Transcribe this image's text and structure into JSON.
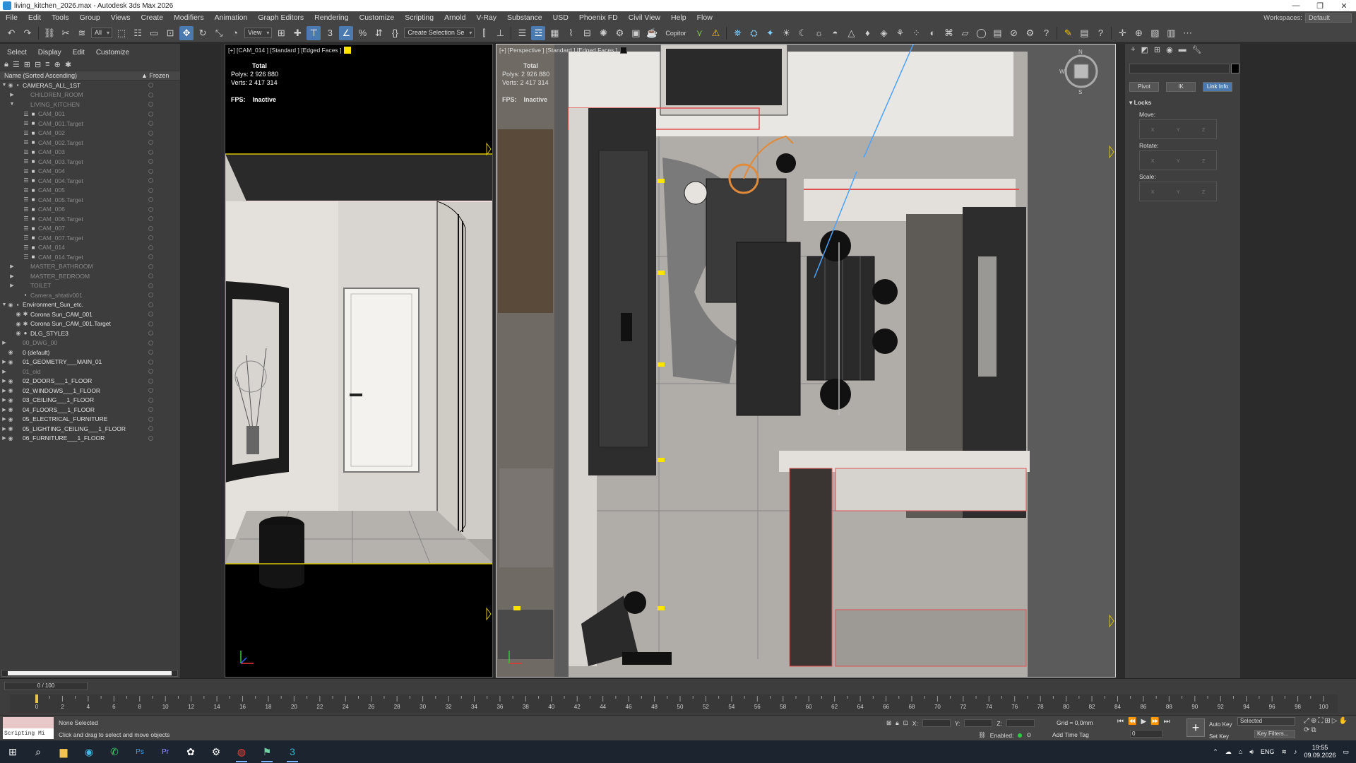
{
  "window": {
    "title": "living_kitchen_2026.max - Autodesk 3ds Max 2026",
    "controls": [
      "—",
      "❐",
      "✕"
    ]
  },
  "menubar": {
    "items": [
      "File",
      "Edit",
      "Tools",
      "Group",
      "Views",
      "Create",
      "Modifiers",
      "Animation",
      "Graph Editors",
      "Rendering",
      "Customize",
      "Scripting",
      "Arnold",
      "V-Ray",
      "Substance",
      "USD",
      "Phoenix FD",
      "Civil View",
      "Help",
      "Flow"
    ],
    "workspaces_label": "Workspaces:",
    "workspaces_value": "Default"
  },
  "toolbar": {
    "selection_filter": "All",
    "ref_coord": "View",
    "named_selection": "Create Selection Se",
    "copitor_label": "Copitor",
    "accent_color": "#4a7ab0"
  },
  "explorer": {
    "menu": [
      "Select",
      "Display",
      "Edit",
      "Customize"
    ],
    "col_name": "Name (Sorted Ascending)",
    "col_frozen": "▲ Frozen",
    "rows": [
      {
        "indent": 0,
        "expand": "▼",
        "eye": "◉",
        "name": "CAMERAS_ALL_1ST",
        "dim": false,
        "obj": "▪"
      },
      {
        "indent": 1,
        "expand": "▶",
        "eye": "",
        "name": "CHILDREN_ROOM",
        "dim": true,
        "obj": ""
      },
      {
        "indent": 1,
        "expand": "▼",
        "eye": "",
        "name": "LIVING_KITCHEN",
        "dim": true,
        "obj": ""
      },
      {
        "indent": 2,
        "expand": "",
        "eye": "☰",
        "name": "CAM_001",
        "dim": true,
        "obj": "■"
      },
      {
        "indent": 2,
        "expand": "",
        "eye": "☰",
        "name": "CAM_001.Target",
        "dim": true,
        "obj": "■"
      },
      {
        "indent": 2,
        "expand": "",
        "eye": "☰",
        "name": "CAM_002",
        "dim": true,
        "obj": "■"
      },
      {
        "indent": 2,
        "expand": "",
        "eye": "☰",
        "name": "CAM_002.Target",
        "dim": true,
        "obj": "■"
      },
      {
        "indent": 2,
        "expand": "",
        "eye": "☰",
        "name": "CAM_003",
        "dim": true,
        "obj": "■"
      },
      {
        "indent": 2,
        "expand": "",
        "eye": "☰",
        "name": "CAM_003.Target",
        "dim": true,
        "obj": "■"
      },
      {
        "indent": 2,
        "expand": "",
        "eye": "☰",
        "name": "CAM_004",
        "dim": true,
        "obj": "■"
      },
      {
        "indent": 2,
        "expand": "",
        "eye": "☰",
        "name": "CAM_004.Target",
        "dim": true,
        "obj": "■"
      },
      {
        "indent": 2,
        "expand": "",
        "eye": "☰",
        "name": "CAM_005",
        "dim": true,
        "obj": "■"
      },
      {
        "indent": 2,
        "expand": "",
        "eye": "☰",
        "name": "CAM_005.Target",
        "dim": true,
        "obj": "■"
      },
      {
        "indent": 2,
        "expand": "",
        "eye": "☰",
        "name": "CAM_006",
        "dim": true,
        "obj": "■"
      },
      {
        "indent": 2,
        "expand": "",
        "eye": "☰",
        "name": "CAM_006.Target",
        "dim": true,
        "obj": "■"
      },
      {
        "indent": 2,
        "expand": "",
        "eye": "☰",
        "name": "CAM_007",
        "dim": true,
        "obj": "■"
      },
      {
        "indent": 2,
        "expand": "",
        "eye": "☰",
        "name": "CAM_007.Target",
        "dim": true,
        "obj": "■"
      },
      {
        "indent": 2,
        "expand": "",
        "eye": "☰",
        "name": "CAM_014",
        "dim": true,
        "obj": "■"
      },
      {
        "indent": 2,
        "expand": "",
        "eye": "☰",
        "name": "CAM_014.Target",
        "dim": true,
        "obj": "■"
      },
      {
        "indent": 1,
        "expand": "▶",
        "eye": "",
        "name": "MASTER_BATHROOM",
        "dim": true,
        "obj": ""
      },
      {
        "indent": 1,
        "expand": "▶",
        "eye": "",
        "name": "MASTER_BEDROOM",
        "dim": true,
        "obj": ""
      },
      {
        "indent": 1,
        "expand": "▶",
        "eye": "",
        "name": "TOILET",
        "dim": true,
        "obj": ""
      },
      {
        "indent": 1,
        "expand": "",
        "eye": "",
        "name": "Camera_shtativ001",
        "dim": true,
        "obj": "▪"
      },
      {
        "indent": 0,
        "expand": "▼",
        "eye": "◉",
        "name": "Environment_Sun_etc.",
        "dim": false,
        "obj": "▪"
      },
      {
        "indent": 1,
        "expand": "",
        "eye": "◉",
        "name": "Corona Sun_CAM_001",
        "dim": false,
        "obj": "✱"
      },
      {
        "indent": 1,
        "expand": "",
        "eye": "◉",
        "name": "Corona Sun_CAM_001.Target",
        "dim": false,
        "obj": "✱"
      },
      {
        "indent": 1,
        "expand": "",
        "eye": "◉",
        "name": "DLG_STYLE3",
        "dim": false,
        "obj": "●"
      },
      {
        "indent": 0,
        "expand": "▶",
        "eye": "",
        "name": "00_DWG_00",
        "dim": true,
        "obj": ""
      },
      {
        "indent": 0,
        "expand": "",
        "eye": "◉",
        "name": "0 (default)",
        "dim": false,
        "obj": ""
      },
      {
        "indent": 0,
        "expand": "▶",
        "eye": "◉",
        "name": "01_GEOMETRY___MAIN_01",
        "dim": false,
        "obj": ""
      },
      {
        "indent": 0,
        "expand": "▶",
        "eye": "",
        "name": "01_old",
        "dim": true,
        "obj": ""
      },
      {
        "indent": 0,
        "expand": "▶",
        "eye": "◉",
        "name": "02_DOORS___1_FLOOR",
        "dim": false,
        "obj": ""
      },
      {
        "indent": 0,
        "expand": "▶",
        "eye": "◉",
        "name": "02_WINDOWS___1_FLOOR",
        "dim": false,
        "obj": ""
      },
      {
        "indent": 0,
        "expand": "▶",
        "eye": "◉",
        "name": "03_CEILING___1_FLOOR",
        "dim": false,
        "obj": ""
      },
      {
        "indent": 0,
        "expand": "▶",
        "eye": "◉",
        "name": "04_FLOORS___1_FLOOR",
        "dim": false,
        "obj": ""
      },
      {
        "indent": 0,
        "expand": "▶",
        "eye": "◉",
        "name": "05_ELECTRICAL_FURNITURE",
        "dim": false,
        "obj": ""
      },
      {
        "indent": 0,
        "expand": "▶",
        "eye": "◉",
        "name": "05_LIGHTING_CEILING___1_FLOOR",
        "dim": false,
        "obj": ""
      },
      {
        "indent": 0,
        "expand": "▶",
        "eye": "◉",
        "name": "06_FURNITURE___1_FLOOR",
        "dim": false,
        "obj": ""
      }
    ]
  },
  "viewport_left": {
    "label": "[+] [CAM_014 ] [Standard ] [Edged Faces ]",
    "stats_total": "Total",
    "polys_label": "Polys:",
    "polys_value": "2 926 880",
    "verts_label": "Verts:",
    "verts_value": "2 417 314",
    "fps_label": "FPS:",
    "fps_value": "Inactive",
    "swatch_color": "#ffe400"
  },
  "viewport_main": {
    "label": "[+] [Perspective ] [Standard ] [Edged Faces ]",
    "stats_total": "Total",
    "polys_label": "Polys:",
    "polys_value": "2 926 880",
    "verts_label": "Verts:",
    "verts_value": "2 417 314",
    "fps_label": "FPS:",
    "fps_value": "Inactive",
    "viewcube_letters": [
      "N",
      "W",
      "S"
    ],
    "selection_color": "#e05050",
    "highlight_color": "#e08a3a"
  },
  "command_panel": {
    "buttons": [
      "Pivot",
      "IK",
      "Link Info"
    ],
    "rollout_title": "Locks",
    "groups": [
      {
        "label": "Move:",
        "axes": [
          "X",
          "Y",
          "Z"
        ]
      },
      {
        "label": "Rotate:",
        "axes": [
          "X",
          "Y",
          "Z"
        ]
      },
      {
        "label": "Scale:",
        "axes": [
          "X",
          "Y",
          "Z"
        ]
      }
    ]
  },
  "timeline": {
    "position": "0 / 100",
    "ticks": [
      0,
      2,
      4,
      6,
      8,
      10,
      12,
      14,
      16,
      18,
      20,
      22,
      24,
      26,
      28,
      30,
      32,
      34,
      36,
      38,
      40,
      42,
      44,
      46,
      48,
      50,
      52,
      54,
      56,
      58,
      60,
      62,
      64,
      66,
      68,
      70,
      72,
      74,
      76,
      78,
      80,
      82,
      84,
      86,
      88,
      90,
      92,
      94,
      96,
      98,
      100
    ]
  },
  "status": {
    "script_label": "Scripting Mi",
    "selection": "None Selected",
    "prompt": "Click and drag to select and move objects",
    "x_label": "X:",
    "y_label": "Y:",
    "z_label": "Z:",
    "grid": "Grid = 0,0mm",
    "enabled_label": "Enabled:",
    "add_time_tag": "Add Time Tag",
    "frame_value": "0",
    "auto_key": "Auto Key",
    "set_key": "Set Key",
    "key_mode": "Selected",
    "key_filters": "Key Filters..."
  },
  "taskbar": {
    "lang": "ENG",
    "time": "19:55",
    "date": "09.09.2026"
  }
}
